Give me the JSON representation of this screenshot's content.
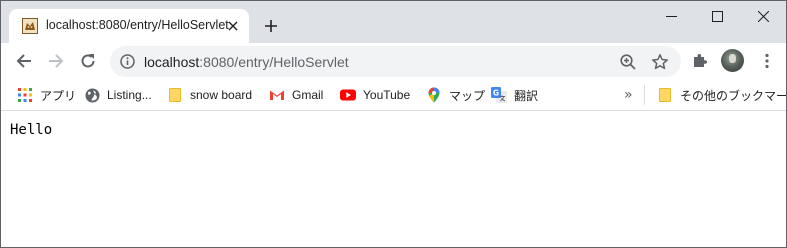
{
  "tab": {
    "title": "localhost:8080/entry/HelloServlet",
    "favicon": "tomcat-icon"
  },
  "window_controls": {
    "minimize": "minimize-icon",
    "maximize": "maximize-icon",
    "close": "close-icon"
  },
  "omnibox": {
    "host": "localhost",
    "path": ":8080/entry/HelloServlet"
  },
  "bookmarks": {
    "items": [
      {
        "label": "アプリ",
        "icon": "apps-grid-icon"
      },
      {
        "label": "Listing...",
        "icon": "globe-icon"
      },
      {
        "label": "snow board",
        "icon": "folder-icon"
      },
      {
        "label": "Gmail",
        "icon": "gmail-icon"
      },
      {
        "label": "YouTube",
        "icon": "youtube-icon"
      },
      {
        "label": "マップ",
        "icon": "maps-pin-icon"
      },
      {
        "label": "翻訳",
        "icon": "translate-icon"
      }
    ],
    "overflow": "»",
    "other": {
      "label": "その他のブックマーク",
      "icon": "folder-icon"
    }
  },
  "page": {
    "body_text": "Hello"
  },
  "colors": {
    "tabstrip": "#dee1e6",
    "omnibox": "#f1f3f4",
    "youtube_red": "#ff0000",
    "folder_yellow": "#fdd663"
  }
}
